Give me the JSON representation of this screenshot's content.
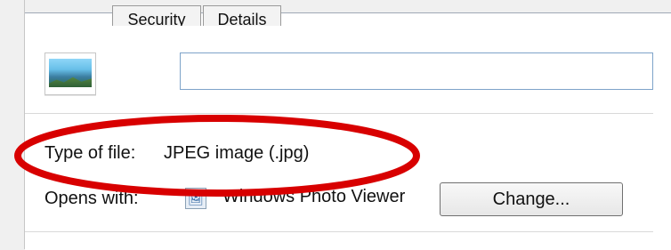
{
  "tabs": [
    {
      "label": "Security"
    },
    {
      "label": "Details"
    }
  ],
  "file_name": "",
  "file_icon": "landscape-image-icon",
  "properties": {
    "type_label": "Type of file:",
    "type_value": "JPEG image (.jpg)",
    "opens_label": "Opens with:",
    "opens_app": "Windows Photo Viewer",
    "opens_icon": "photo-viewer-icon"
  },
  "buttons": {
    "change_label": "Change..."
  },
  "annotation": {
    "shape": "ellipse",
    "color": "#d80000"
  }
}
